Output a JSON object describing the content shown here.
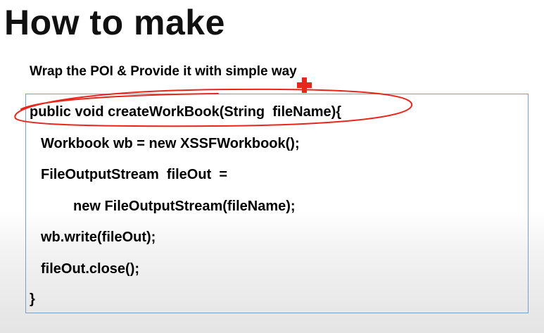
{
  "slide": {
    "title": "How to make",
    "subtitle": "Wrap the POI & Provide it with simple way"
  },
  "code": {
    "lines": [
      "public void createWorkBook(String  fileName){",
      "Workbook wb = new XSSFWorkbook();",
      "FileOutputStream  fileOut  =",
      "new FileOutputStream(fileName);",
      "wb.write(fileOut);",
      "fileOut.close();",
      "}"
    ]
  },
  "annotation": {
    "circle_color": "#e8261c",
    "cursor_color": "#e8261c",
    "cursor_icon": "red-cross-cursor"
  },
  "colors": {
    "code_box_border": "#7c9dc6"
  }
}
